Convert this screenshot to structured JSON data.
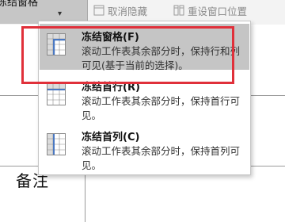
{
  "ribbon": {
    "freeze_button_label": "冻结窗格",
    "freeze_button_caret": "▾",
    "unhide_label": "取消隐藏",
    "reset_window_label": "重设窗口位置"
  },
  "sheet": {
    "cell_text": "备注"
  },
  "menu": {
    "items": [
      {
        "title": "冻结窗格(F)",
        "description": "滚动工作表其余部分时，保持行和列可见(基于当前的选择)。",
        "icon": "freeze-panes-icon",
        "highlighted": true
      },
      {
        "title": "冻结首行(R)",
        "description": "滚动工作表其余部分时，保持首行可见。",
        "icon": "freeze-top-row-icon",
        "highlighted": false
      },
      {
        "title": "冻结首列(C)",
        "description": "滚动工作表其余部分时，保持首列可见。",
        "icon": "freeze-first-column-icon",
        "highlighted": false
      }
    ]
  },
  "colors": {
    "highlight_border": "#e0303a",
    "menu_highlight": "#c5c5c5",
    "icon_blue": "#4a78c2"
  }
}
